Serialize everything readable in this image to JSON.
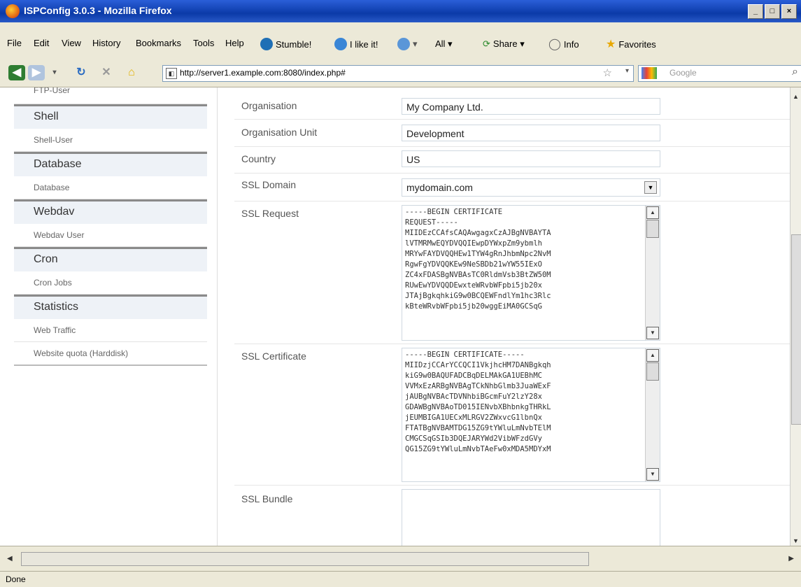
{
  "window": {
    "title": "ISPConfig 3.0.3 - Mozilla Firefox",
    "min": "_",
    "max": "□",
    "close": "×"
  },
  "menu": [
    "File",
    "Edit",
    "View",
    "History",
    "Bookmarks",
    "Tools",
    "Help"
  ],
  "toolbar": {
    "stumble": "Stumble!",
    "ilike": "I like it!",
    "all": "All ▾",
    "share": "Share ▾",
    "info": "Info",
    "favorites": "Favorites"
  },
  "nav": {
    "url": "http://server1.example.com:8080/index.php#",
    "search_placeholder": "Google"
  },
  "sidebar": {
    "top_item": "FTP-User",
    "sections": [
      {
        "title": "Shell",
        "items": [
          "Shell-User"
        ]
      },
      {
        "title": "Database",
        "items": [
          "Database"
        ]
      },
      {
        "title": "Webdav",
        "items": [
          "Webdav User"
        ]
      },
      {
        "title": "Cron",
        "items": [
          "Cron Jobs"
        ]
      },
      {
        "title": "Statistics",
        "items": [
          "Web Traffic",
          "Website quota (Harddisk)"
        ]
      }
    ]
  },
  "form": {
    "organisation": {
      "label": "Organisation",
      "value": "My Company Ltd."
    },
    "org_unit": {
      "label": "Organisation Unit",
      "value": "Development"
    },
    "country": {
      "label": "Country",
      "value": "US"
    },
    "ssl_domain": {
      "label": "SSL Domain",
      "value": "mydomain.com"
    },
    "ssl_request": {
      "label": "SSL Request",
      "value": "-----BEGIN CERTIFICATE\nREQUEST-----\nMIIDEzCCAfsCAQAwgagxCzAJBgNVBAYTA\nlVTMRMwEQYDVQQIEwpDYWxpZm9ybmlh\nMRYwFAYDVQQHEw1TYW4gRnJhbmNpc2NvM\nRgwFgYDVQQKEw9NeSBDb21wYW55IExO\nZC4xFDASBgNVBAsTC0RldmVsb3BtZW50M\nRUwEwYDVQQDEwxteWRvbWFpbi5jb20x\nJTAjBgkqhkiG9w0BCQEWFndlYm1hc3Rlc\nkBteWRvbWFpbi5jb20wggEiMA0GCSqG"
    },
    "ssl_certificate": {
      "label": "SSL Certificate",
      "value": "-----BEGIN CERTIFICATE-----\nMIIDzjCCArYCCQCI1VkjhcHM7DANBgkqh\nkiG9w0BAQUFADCBqDELMAkGA1UEBhMC\nVVMxEzARBgNVBAgTCkNhbGlmb3JuaWExF\njAUBgNVBAcTDVNhbiBGcmFuY2lzY28x\nGDAWBgNVBAoTD015IENvbXBhbnkgTHRkL\njEUMBIGA1UECxMLRGV2ZWxvcG1lbnQx\nFTATBgNVBAMTDG15ZG9tYWluLmNvbTElM\nCMGCSqGSIb3DQEJARYWd2VibWFzdGVy\nQG15ZG9tYWluLmNvbTAeFw0xMDA5MDYxM"
    },
    "ssl_bundle": {
      "label": "SSL Bundle",
      "value": ""
    }
  },
  "status": "Done"
}
